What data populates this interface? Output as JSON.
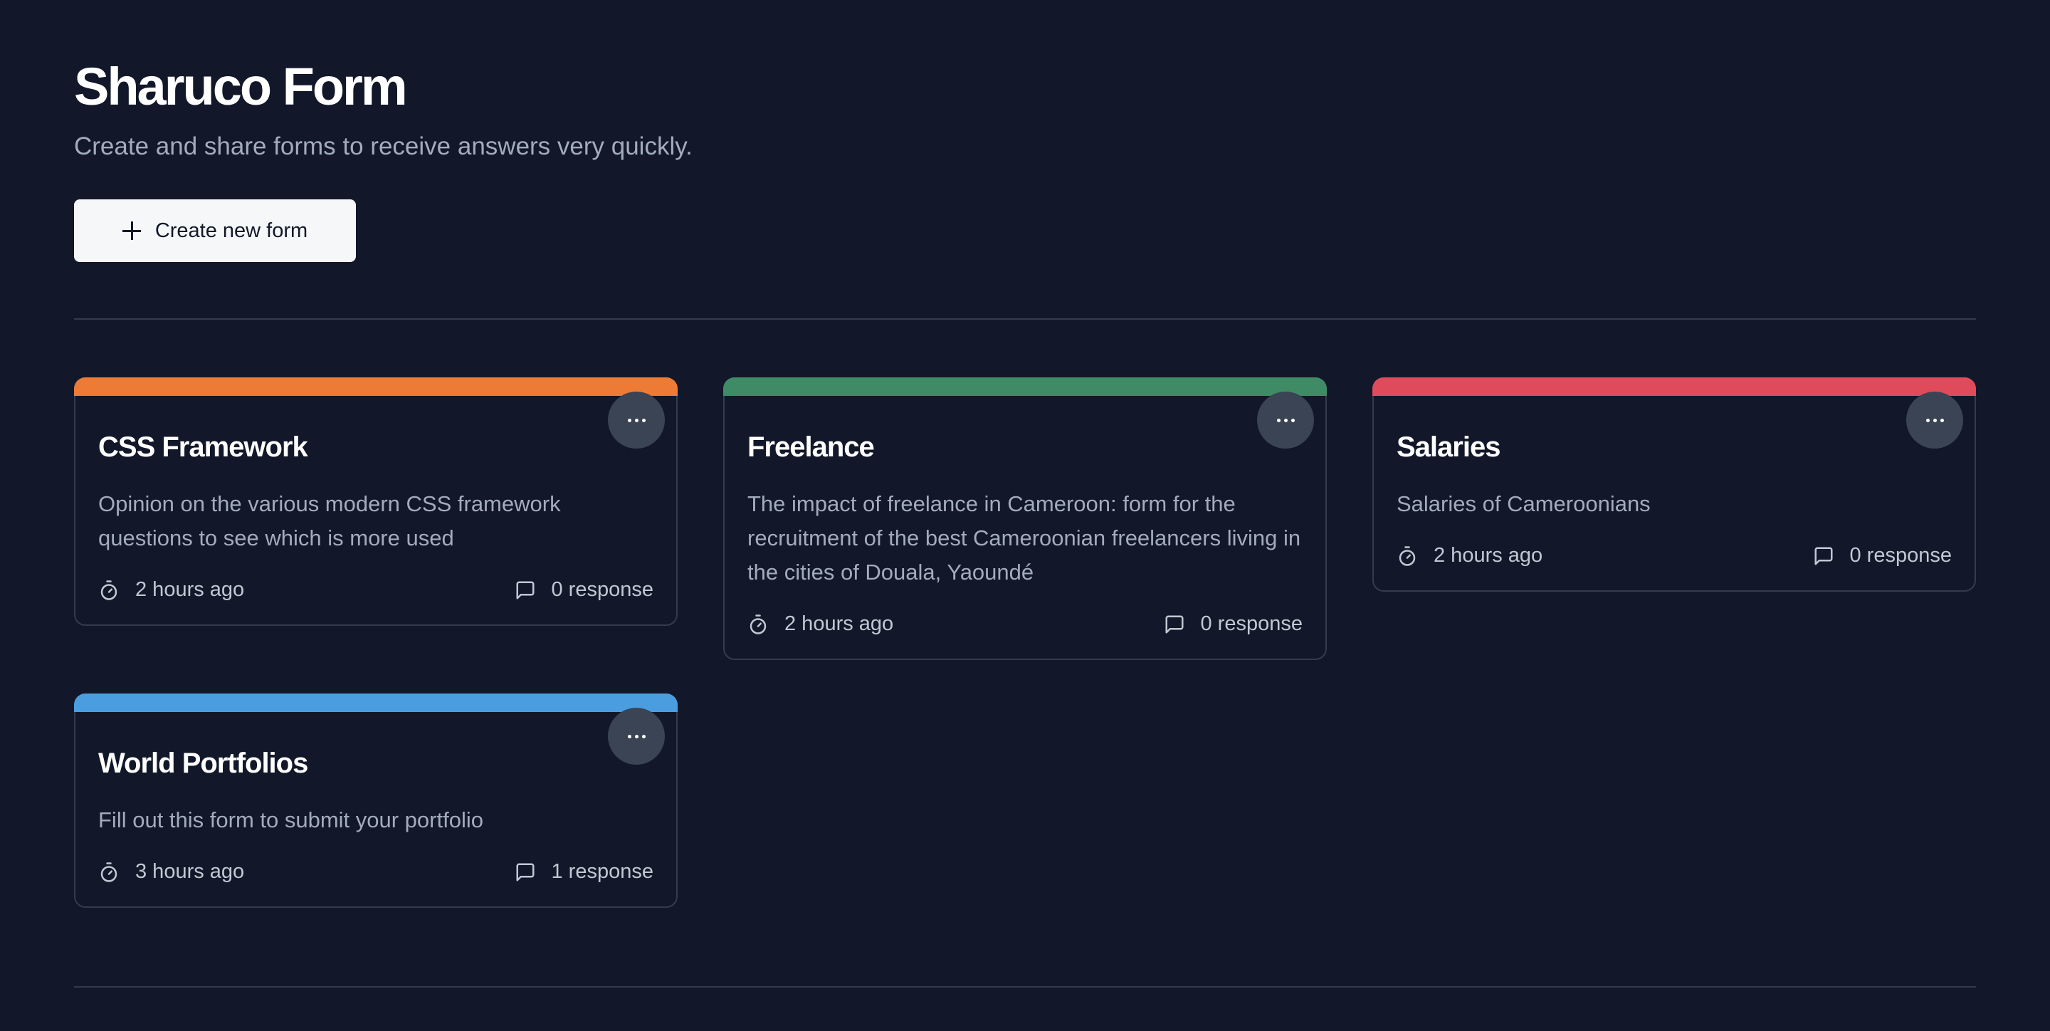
{
  "header": {
    "title": "Sharuco Form",
    "subtitle": "Create and share forms to receive answers very quickly."
  },
  "actions": {
    "create_label": "Create new form"
  },
  "forms": [
    {
      "title": "CSS Framework",
      "description": "Opinion on the various modern CSS framework questions to see which is more used",
      "time": "2 hours ago",
      "responses": "0 response",
      "accent_color": "#ed7b35"
    },
    {
      "title": "Freelance",
      "description": "The impact of freelance in Cameroon: form for the recruitment of the best Cameroonian freelancers living in the cities of Douala, Yaoundé",
      "time": "2 hours ago",
      "responses": "0 response",
      "accent_color": "#3f8b66"
    },
    {
      "title": "Salaries",
      "description": "Salaries of Cameroonians",
      "time": "2 hours ago",
      "responses": "0 response",
      "accent_color": "#e04b5c"
    },
    {
      "title": "World Portfolios",
      "description": "Fill out this form to submit your portfolio",
      "time": "3 hours ago",
      "responses": "1 response",
      "accent_color": "#4a9ee0"
    }
  ],
  "icons": {
    "create": "plus-icon",
    "menu": "more-horizontal-icon",
    "time": "stopwatch-icon",
    "responses": "message-square-icon"
  }
}
